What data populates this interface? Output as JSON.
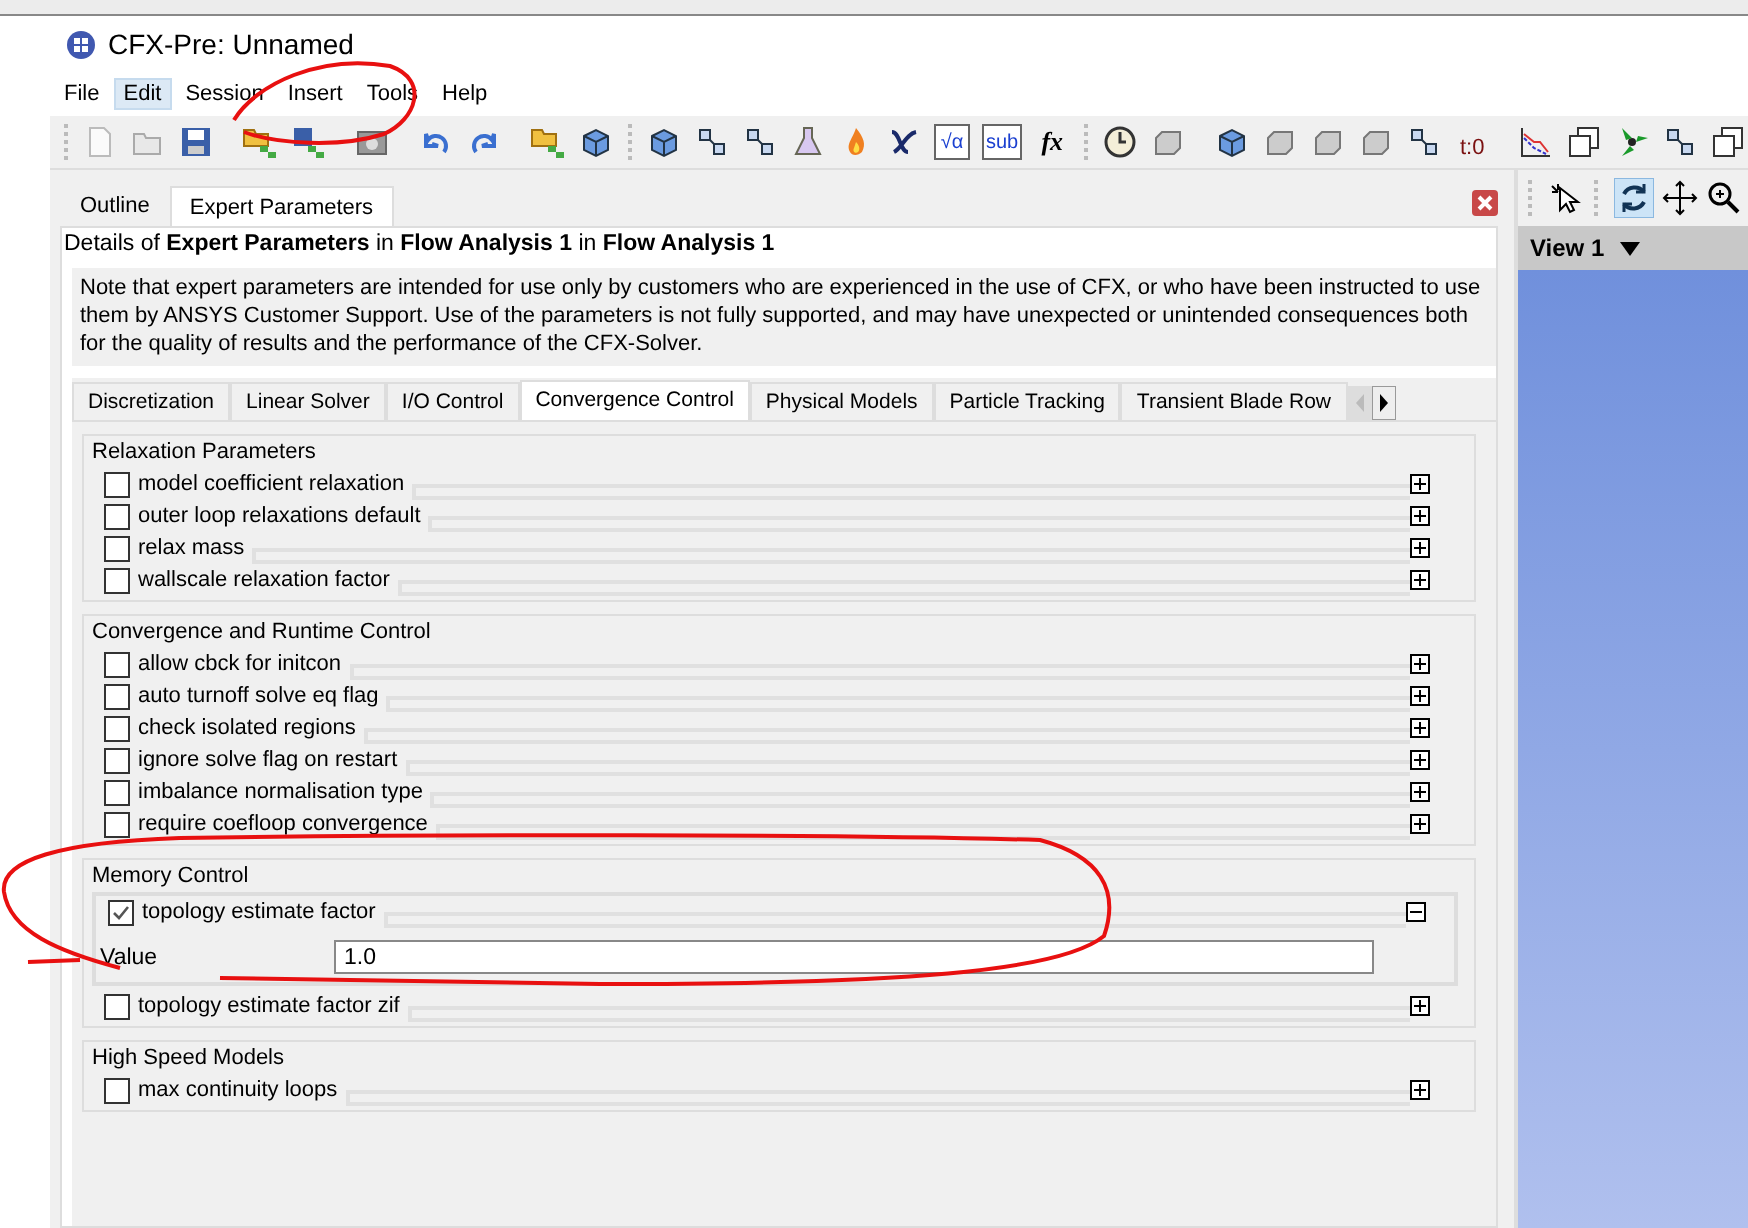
{
  "window": {
    "title": "CFX-Pre:  Unnamed"
  },
  "menu": [
    {
      "label": "File",
      "selected": false
    },
    {
      "label": "Edit",
      "selected": true
    },
    {
      "label": "Session",
      "selected": false
    },
    {
      "label": "Insert",
      "selected": false
    },
    {
      "label": "Tools",
      "selected": false
    },
    {
      "label": "Help",
      "selected": false
    }
  ],
  "toolbar": {
    "text_icons": [
      "√α",
      "sub",
      "fx",
      "t:0"
    ]
  },
  "panel_tabs": [
    {
      "label": "Outline",
      "selected": false
    },
    {
      "label": "Expert Parameters",
      "selected": true
    }
  ],
  "details": "Details of **Expert Parameters** in **Flow Analysis 1** in **Flow Analysis 1**",
  "note": "Note that expert parameters are intended for use only by customers who are experienced in the use of CFX, or who have been instructed to use them by ANSYS Customer Support. Use of the parameters is not fully supported, and may have unexpected or unintended consequences both for the quality of results and the performance of the CFX-Solver.",
  "sub_tabs": [
    {
      "label": "Discretization",
      "selected": false
    },
    {
      "label": "Linear Solver",
      "selected": false
    },
    {
      "label": "I/O Control",
      "selected": false
    },
    {
      "label": "Convergence Control",
      "selected": true
    },
    {
      "label": "Physical Models",
      "selected": false
    },
    {
      "label": "Particle Tracking",
      "selected": false
    },
    {
      "label": "Transient Blade Row",
      "selected": false
    }
  ],
  "groups": [
    {
      "title": "Relaxation Parameters",
      "items": [
        {
          "label": "model coefficient relaxation",
          "checked": false,
          "expanded": false
        },
        {
          "label": "outer loop relaxations default",
          "checked": false,
          "expanded": false
        },
        {
          "label": "relax mass",
          "checked": false,
          "expanded": false
        },
        {
          "label": "wallscale relaxation factor",
          "checked": false,
          "expanded": false
        }
      ]
    },
    {
      "title": "Convergence and Runtime Control",
      "items": [
        {
          "label": "allow cbck for initcon",
          "checked": false,
          "expanded": false
        },
        {
          "label": "auto turnoff solve eq flag",
          "checked": false,
          "expanded": false
        },
        {
          "label": "check isolated regions",
          "checked": false,
          "expanded": false
        },
        {
          "label": "ignore solve flag on restart",
          "checked": false,
          "expanded": false
        },
        {
          "label": "imbalance normalisation type",
          "checked": false,
          "expanded": false
        },
        {
          "label": "require coefloop convergence",
          "checked": false,
          "expanded": false
        }
      ]
    },
    {
      "title": "Memory Control",
      "items": [
        {
          "label": "topology estimate factor",
          "checked": true,
          "expanded": true,
          "field": {
            "label": "Value",
            "value": "1.0"
          }
        },
        {
          "label": "topology estimate factor zif",
          "checked": false,
          "expanded": false
        }
      ]
    },
    {
      "title": "High Speed Models",
      "items": [
        {
          "label": "max continuity loops",
          "checked": false,
          "expanded": false
        }
      ]
    }
  ],
  "viewer": {
    "title": "View 1"
  }
}
